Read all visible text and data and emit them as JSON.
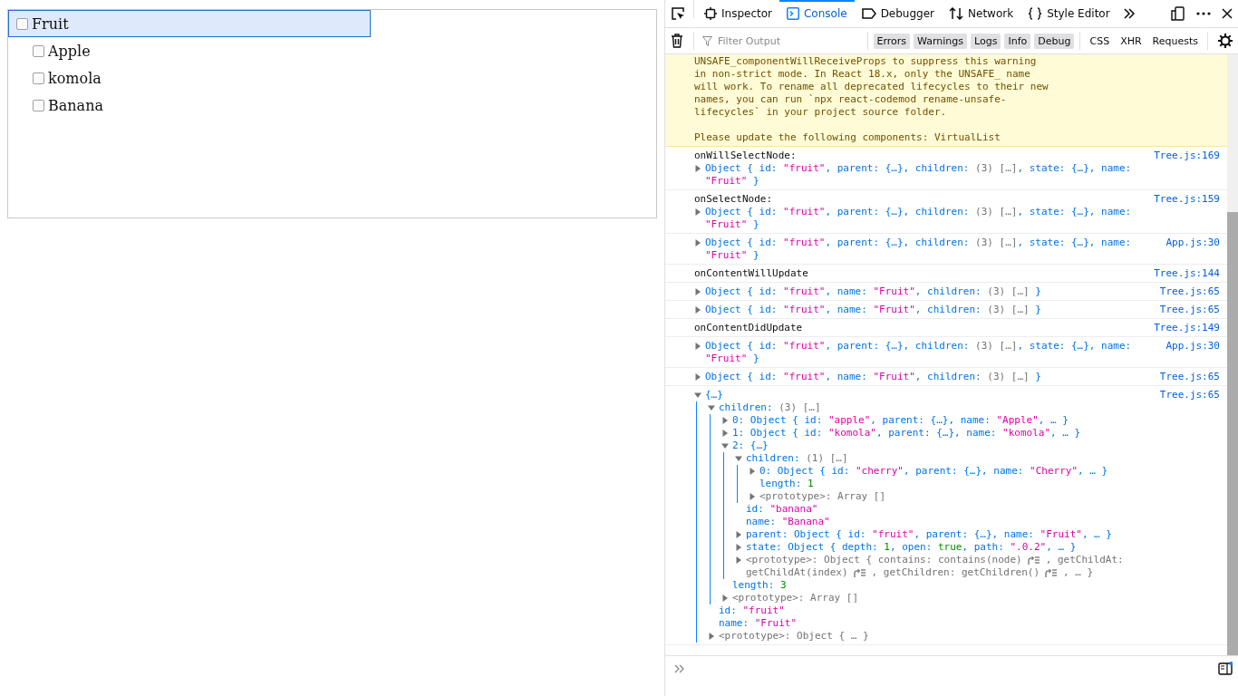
{
  "tree": {
    "items": [
      {
        "label": "Fruit",
        "checked": false,
        "selected": true,
        "children": [
          {
            "label": "Apple",
            "checked": false,
            "selected": false
          },
          {
            "label": "komola",
            "checked": false,
            "selected": false
          },
          {
            "label": "Banana",
            "checked": false,
            "selected": false
          }
        ]
      }
    ]
  },
  "devtools": {
    "tabs": [
      {
        "label": "Inspector",
        "selected": false
      },
      {
        "label": "Console",
        "selected": true
      },
      {
        "label": "Debugger",
        "selected": false
      },
      {
        "label": "Network",
        "selected": false
      },
      {
        "label": "Style Editor",
        "selected": false
      }
    ],
    "filter": {
      "placeholder": "Filter Output"
    },
    "levels": [
      {
        "label": "Errors",
        "selected": true
      },
      {
        "label": "Warnings",
        "selected": true
      },
      {
        "label": "Logs",
        "selected": true
      },
      {
        "label": "Info",
        "selected": true
      },
      {
        "label": "Debug",
        "selected": true
      }
    ],
    "categories": [
      {
        "label": "CSS",
        "selected": false
      },
      {
        "label": "XHR",
        "selected": false
      },
      {
        "label": "Requests",
        "selected": false
      }
    ],
    "messages": [
      {
        "kind": "warning",
        "text": "UNSAFE_componentWillReceiveProps to suppress this warning\nin non-strict mode. In React 18.x, only the UNSAFE_ name\nwill work. To rename all deprecated lifecycles to their new\nnames, you can run `npx react-codemod rename-unsafe-\nlifecycles` in your project source folder.\n\nPlease update the following components: VirtualList"
      },
      {
        "kind": "log",
        "label": "onWillSelectNode:",
        "source": "Tree.js:169",
        "objects": [
          {
            "expanded": false,
            "tokens": [
              {
                "kind": "key",
                "text": "Object { id: "
              },
              {
                "kind": "string",
                "text": "\"fruit\""
              },
              {
                "kind": "key",
                "text": ", parent: {…}, children: "
              },
              {
                "kind": "muted",
                "text": "(3) […]"
              },
              {
                "kind": "key",
                "text": ", state: {…}, name: "
              },
              {
                "kind": "string",
                "text": "\"Fruit\""
              },
              {
                "kind": "key",
                "text": " }"
              }
            ]
          }
        ]
      },
      {
        "kind": "log",
        "label": "onSelectNode:",
        "source": "Tree.js:159",
        "objects": [
          {
            "expanded": false,
            "tokens": [
              {
                "kind": "key",
                "text": "Object { id: "
              },
              {
                "kind": "string",
                "text": "\"fruit\""
              },
              {
                "kind": "key",
                "text": ", parent: {…}, children: "
              },
              {
                "kind": "muted",
                "text": "(3) […]"
              },
              {
                "kind": "key",
                "text": ", state: {…}, name: "
              },
              {
                "kind": "string",
                "text": "\"Fruit\""
              },
              {
                "kind": "key",
                "text": " }"
              }
            ]
          }
        ]
      },
      {
        "kind": "log",
        "source": "App.js:30",
        "objects": [
          {
            "expanded": false,
            "tokens": [
              {
                "kind": "key",
                "text": "Object { id: "
              },
              {
                "kind": "string",
                "text": "\"fruit\""
              },
              {
                "kind": "key",
                "text": ", parent: {…}, children: "
              },
              {
                "kind": "muted",
                "text": "(3) […]"
              },
              {
                "kind": "key",
                "text": ", state: {…}, name: "
              },
              {
                "kind": "string",
                "text": "\"Fruit\""
              },
              {
                "kind": "key",
                "text": " }"
              }
            ]
          }
        ]
      },
      {
        "kind": "log",
        "label": "onContentWillUpdate",
        "source": "Tree.js:144"
      },
      {
        "kind": "log",
        "source": "Tree.js:65",
        "objects": [
          {
            "expanded": false,
            "tokens": [
              {
                "kind": "key",
                "text": "Object { id: "
              },
              {
                "kind": "string",
                "text": "\"fruit\""
              },
              {
                "kind": "key",
                "text": ", name: "
              },
              {
                "kind": "string",
                "text": "\"Fruit\""
              },
              {
                "kind": "key",
                "text": ", children: "
              },
              {
                "kind": "muted",
                "text": "(3) […]"
              },
              {
                "kind": "key",
                "text": " }"
              }
            ]
          }
        ]
      },
      {
        "kind": "log",
        "source": "Tree.js:65",
        "objects": [
          {
            "expanded": false,
            "tokens": [
              {
                "kind": "key",
                "text": "Object { id: "
              },
              {
                "kind": "string",
                "text": "\"fruit\""
              },
              {
                "kind": "key",
                "text": ", name: "
              },
              {
                "kind": "string",
                "text": "\"Fruit\""
              },
              {
                "kind": "key",
                "text": ", children: "
              },
              {
                "kind": "muted",
                "text": "(3) […]"
              },
              {
                "kind": "key",
                "text": " }"
              }
            ]
          }
        ]
      },
      {
        "kind": "log",
        "label": "onContentDidUpdate",
        "source": "Tree.js:149"
      },
      {
        "kind": "log",
        "source": "App.js:30",
        "objects": [
          {
            "expanded": false,
            "tokens": [
              {
                "kind": "key",
                "text": "Object { id: "
              },
              {
                "kind": "string",
                "text": "\"fruit\""
              },
              {
                "kind": "key",
                "text": ", parent: {…}, children: "
              },
              {
                "kind": "muted",
                "text": "(3) […]"
              },
              {
                "kind": "key",
                "text": ", state: {…}, name: "
              },
              {
                "kind": "string",
                "text": "\"Fruit\""
              },
              {
                "kind": "key",
                "text": " }"
              }
            ]
          }
        ]
      },
      {
        "kind": "log",
        "source": "Tree.js:65",
        "objects": [
          {
            "expanded": false,
            "tokens": [
              {
                "kind": "key",
                "text": "Object { id: "
              },
              {
                "kind": "string",
                "text": "\"fruit\""
              },
              {
                "kind": "key",
                "text": ", name: "
              },
              {
                "kind": "string",
                "text": "\"Fruit\""
              },
              {
                "kind": "key",
                "text": ", children: "
              },
              {
                "kind": "muted",
                "text": "(3) […]"
              },
              {
                "kind": "key",
                "text": " }"
              }
            ]
          }
        ]
      },
      {
        "kind": "log",
        "source": "Tree.js:65",
        "objects": [
          {
            "expanded": true,
            "tokens": [
              {
                "kind": "key",
                "text": "{…}"
              }
            ],
            "children": [
              {
                "expanded": true,
                "tokens": [
                  {
                    "kind": "key",
                    "text": "children: "
                  },
                  {
                    "kind": "muted",
                    "text": "(3) […]"
                  }
                ],
                "children": [
                  {
                    "expanded": false,
                    "tokens": [
                      {
                        "kind": "key",
                        "text": "0: Object { id: "
                      },
                      {
                        "kind": "string",
                        "text": "\"apple\""
                      },
                      {
                        "kind": "key",
                        "text": ", parent: {…}, name: "
                      },
                      {
                        "kind": "string",
                        "text": "\"Apple\""
                      },
                      {
                        "kind": "key",
                        "text": ", … }"
                      }
                    ]
                  },
                  {
                    "expanded": false,
                    "tokens": [
                      {
                        "kind": "key",
                        "text": "1: Object { id: "
                      },
                      {
                        "kind": "string",
                        "text": "\"komola\""
                      },
                      {
                        "kind": "key",
                        "text": ", parent: {…}, name: "
                      },
                      {
                        "kind": "string",
                        "text": "\"komola\""
                      },
                      {
                        "kind": "key",
                        "text": ", … }"
                      }
                    ]
                  },
                  {
                    "expanded": true,
                    "tokens": [
                      {
                        "kind": "key",
                        "text": "2: {…}"
                      }
                    ],
                    "children": [
                      {
                        "expanded": true,
                        "tokens": [
                          {
                            "kind": "key",
                            "text": "children: "
                          },
                          {
                            "kind": "muted",
                            "text": "(1) […]"
                          }
                        ],
                        "children": [
                          {
                            "expanded": false,
                            "tokens": [
                              {
                                "kind": "key",
                                "text": "0: Object { id: "
                              },
                              {
                                "kind": "string",
                                "text": "\"cherry\""
                              },
                              {
                                "kind": "key",
                                "text": ", parent: {…}, name: "
                              },
                              {
                                "kind": "string",
                                "text": "\"Cherry\""
                              },
                              {
                                "kind": "key",
                                "text": ", … }"
                              }
                            ]
                          },
                          {
                            "tokens": [
                              {
                                "kind": "key",
                                "text": "length: "
                              },
                              {
                                "kind": "number",
                                "text": "1"
                              }
                            ]
                          },
                          {
                            "expanded": false,
                            "tokens": [
                              {
                                "kind": "muted",
                                "text": "<prototype>: Array []"
                              }
                            ]
                          }
                        ]
                      },
                      {
                        "tokens": [
                          {
                            "kind": "key",
                            "text": "id: "
                          },
                          {
                            "kind": "string",
                            "text": "\"banana\""
                          }
                        ]
                      },
                      {
                        "tokens": [
                          {
                            "kind": "key",
                            "text": "name: "
                          },
                          {
                            "kind": "string",
                            "text": "\"Banana\""
                          }
                        ]
                      },
                      {
                        "expanded": false,
                        "tokens": [
                          {
                            "kind": "key",
                            "text": "parent: Object { id: "
                          },
                          {
                            "kind": "string",
                            "text": "\"fruit\""
                          },
                          {
                            "kind": "key",
                            "text": ", parent: {…}, name: "
                          },
                          {
                            "kind": "string",
                            "text": "\"Fruit\""
                          },
                          {
                            "kind": "key",
                            "text": ", … }"
                          }
                        ]
                      },
                      {
                        "expanded": false,
                        "tokens": [
                          {
                            "kind": "key",
                            "text": "state: Object { depth: "
                          },
                          {
                            "kind": "number",
                            "text": "1"
                          },
                          {
                            "kind": "key",
                            "text": ", open: "
                          },
                          {
                            "kind": "number",
                            "text": "true"
                          },
                          {
                            "kind": "key",
                            "text": ", path: "
                          },
                          {
                            "kind": "string",
                            "text": "\".0.2\""
                          },
                          {
                            "kind": "key",
                            "text": ", … }"
                          }
                        ]
                      },
                      {
                        "expanded": false,
                        "tokens": [
                          {
                            "kind": "muted",
                            "text": "<prototype>: Object { contains: contains(node)"
                          },
                          {
                            "kind": "jump"
                          },
                          {
                            "kind": "muted",
                            "text": ", getChildAt:"
                          },
                          {
                            "kind": "muted",
                            "text": "getChildAt(index)"
                          },
                          {
                            "kind": "jump"
                          },
                          {
                            "kind": "muted",
                            "text": ", getChildren: getChildren()"
                          },
                          {
                            "kind": "jump"
                          },
                          {
                            "kind": "muted",
                            "text": ", … }"
                          }
                        ]
                      }
                    ]
                  },
                  {
                    "tokens": [
                      {
                        "kind": "key",
                        "text": "length: "
                      },
                      {
                        "kind": "number",
                        "text": "3"
                      }
                    ]
                  },
                  {
                    "expanded": false,
                    "tokens": [
                      {
                        "kind": "muted",
                        "text": "<prototype>: Array []"
                      }
                    ]
                  }
                ]
              },
              {
                "tokens": [
                  {
                    "kind": "key",
                    "text": "id: "
                  },
                  {
                    "kind": "string",
                    "text": "\"fruit\""
                  }
                ]
              },
              {
                "tokens": [
                  {
                    "kind": "key",
                    "text": "name: "
                  },
                  {
                    "kind": "string",
                    "text": "\"Fruit\""
                  }
                ]
              },
              {
                "expanded": false,
                "tokens": [
                  {
                    "kind": "muted",
                    "text": "<prototype>: Object { … }"
                  }
                ]
              }
            ]
          }
        ]
      }
    ]
  }
}
